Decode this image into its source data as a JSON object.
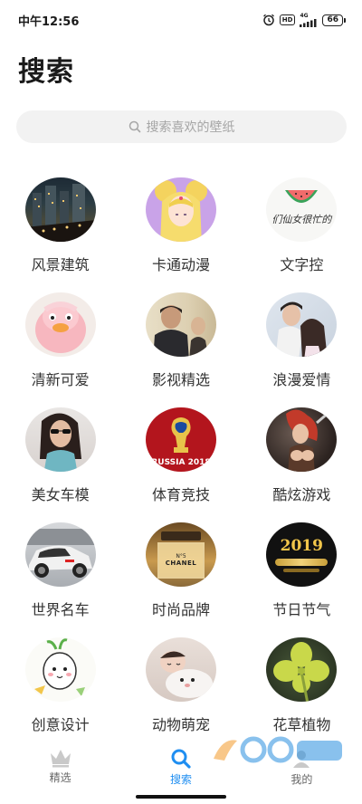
{
  "status_bar": {
    "time": "中午12:56",
    "network": "4G",
    "hd": "HD",
    "battery": "66"
  },
  "header": {
    "title": "搜索"
  },
  "search": {
    "placeholder": "搜索喜欢的壁纸"
  },
  "categories": [
    {
      "label": "风景建筑",
      "icon": "city-night-thumbnail"
    },
    {
      "label": "卡通动漫",
      "icon": "anime-girl-thumbnail"
    },
    {
      "label": "文字控",
      "icon": "watermelon-text-thumbnail",
      "overlay_text": "们仙女很忙的"
    },
    {
      "label": "清新可爱",
      "icon": "pink-duck-thumbnail"
    },
    {
      "label": "影视精选",
      "icon": "movie-still-thumbnail"
    },
    {
      "label": "浪漫爱情",
      "icon": "romantic-couple-thumbnail"
    },
    {
      "label": "美女车模",
      "icon": "woman-sunglasses-thumbnail"
    },
    {
      "label": "体育竞技",
      "icon": "world-cup-thumbnail",
      "overlay_text": "RUSSIA 2018"
    },
    {
      "label": "酷炫游戏",
      "icon": "game-character-thumbnail"
    },
    {
      "label": "世界名车",
      "icon": "sports-car-thumbnail"
    },
    {
      "label": "时尚品牌",
      "icon": "chanel-perfume-thumbnail",
      "overlay_text": "CHANEL"
    },
    {
      "label": "节日节气",
      "icon": "new-year-2019-thumbnail",
      "overlay_text": "2019"
    },
    {
      "label": "创意设计",
      "icon": "cartoon-radish-thumbnail"
    },
    {
      "label": "动物萌宠",
      "icon": "sleeping-pet-thumbnail"
    },
    {
      "label": "花草植物",
      "icon": "clover-leaf-thumbnail"
    }
  ],
  "bottom_nav": [
    {
      "label": "精选",
      "icon": "crown-icon",
      "active": false
    },
    {
      "label": "搜索",
      "icon": "search-icon",
      "active": true
    },
    {
      "label": "我的",
      "icon": "profile-icon",
      "active": false
    }
  ],
  "colors": {
    "accent": "#1f8ef1",
    "search_bg": "#f2f2f2",
    "text": "#333333"
  }
}
